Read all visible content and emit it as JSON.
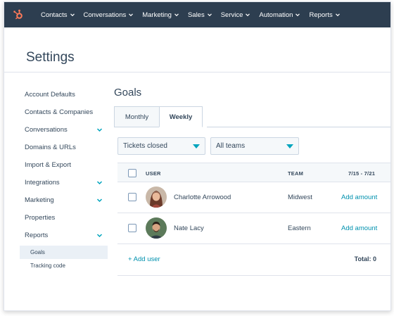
{
  "colors": {
    "nav_bg": "#2d3e50",
    "accent_orange": "#ff7a59",
    "link": "#0091ae",
    "caret": "#00a4bd",
    "active_sub_bg": "#eaf0f6"
  },
  "topnav": {
    "logo_icon": "hubspot-sprocket-icon",
    "items": [
      {
        "label": "Contacts"
      },
      {
        "label": "Conversations"
      },
      {
        "label": "Marketing"
      },
      {
        "label": "Sales"
      },
      {
        "label": "Service"
      },
      {
        "label": "Automation"
      },
      {
        "label": "Reports"
      }
    ]
  },
  "header": {
    "title": "Settings"
  },
  "sidebar": {
    "items": [
      {
        "label": "Account Defaults",
        "expandable": false
      },
      {
        "label": "Contacts & Companies",
        "expandable": false
      },
      {
        "label": "Conversations",
        "expandable": true
      },
      {
        "label": "Domains & URLs",
        "expandable": false
      },
      {
        "label": "Import & Export",
        "expandable": false
      },
      {
        "label": "Integrations",
        "expandable": true
      },
      {
        "label": "Marketing",
        "expandable": true
      },
      {
        "label": "Properties",
        "expandable": false
      },
      {
        "label": "Reports",
        "expandable": true
      }
    ],
    "subitems": [
      {
        "label": "Goals",
        "active": true
      },
      {
        "label": "Tracking code",
        "active": false
      }
    ]
  },
  "main": {
    "title": "Goals",
    "tabs": [
      {
        "label": "Monthly",
        "active": false
      },
      {
        "label": "Weekly",
        "active": true
      }
    ],
    "filters": {
      "metric": "Tickets closed",
      "team": "All teams"
    },
    "table": {
      "columns": [
        "USER",
        "TEAM",
        "7/15 - 7/21"
      ],
      "rows": [
        {
          "name": "Charlotte Arrowood",
          "team": "Midwest",
          "action": "Add amount"
        },
        {
          "name": "Nate Lacy",
          "team": "Eastern",
          "action": "Add amount"
        }
      ],
      "add_user": "+ Add user",
      "total": "Total:  0"
    }
  }
}
